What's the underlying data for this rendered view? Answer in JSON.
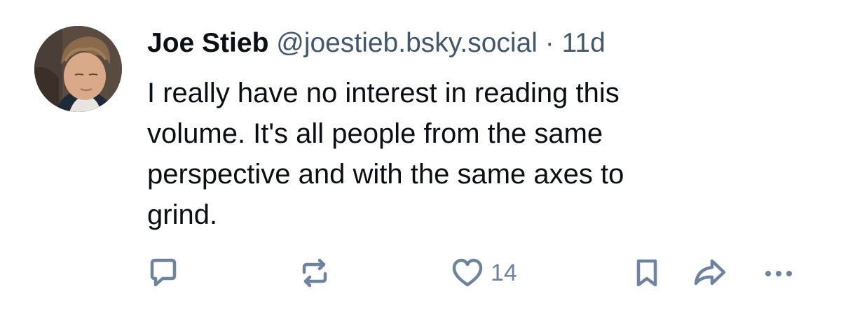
{
  "post": {
    "author": {
      "display_name": "Joe Stieb",
      "handle": "@joestieb.bsky.social",
      "separator": "·",
      "time_ago": "11d"
    },
    "text_lines": [
      "I really have no interest in reading this",
      "volume. It's all people from the same",
      "perspective and with the same axes to",
      "grind."
    ],
    "actions": {
      "reply_icon": "reply-icon",
      "repost_icon": "repost-icon",
      "like_icon": "heart-icon",
      "like_count": "14",
      "bookmark_icon": "bookmark-icon",
      "share_icon": "share-icon",
      "more_icon": "more-icon"
    },
    "colors": {
      "text": "#0b0f14",
      "secondary": "#42576c",
      "icon": "#6f839f",
      "background": "#ffffff"
    }
  }
}
